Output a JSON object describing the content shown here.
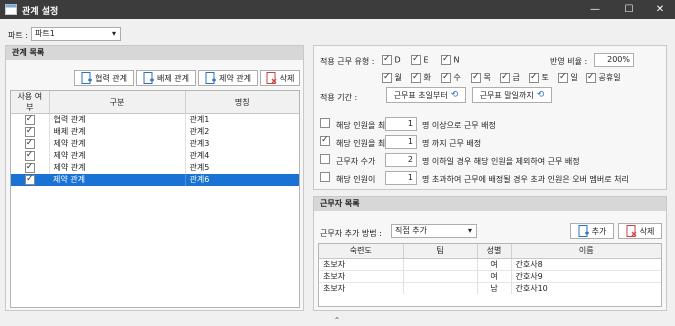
{
  "window": {
    "title": "관계 설정"
  },
  "part": {
    "label": "파트 :",
    "value": "파트1"
  },
  "relation_panel": {
    "title": "관계 목록",
    "buttons": {
      "cooperation": "협력 관계",
      "exclusion": "배제 관계",
      "constraint": "제약 관계",
      "delete": "삭제"
    },
    "columns": [
      "사용 여부",
      "구분",
      "명칭"
    ],
    "rows": [
      {
        "type": "협력 관계",
        "name": "관계1"
      },
      {
        "type": "배제 관계",
        "name": "관계2"
      },
      {
        "type": "제약 관계",
        "name": "관계3"
      },
      {
        "type": "제약 관계",
        "name": "관계4"
      },
      {
        "type": "제약 관계",
        "name": "관계5"
      },
      {
        "type": "제약 관계",
        "name": "관계6"
      }
    ]
  },
  "settings": {
    "duty_type_label": "적용 근무 유형 :",
    "duty_types": [
      "D",
      "E",
      "N"
    ],
    "ratio_label": "반영 비율 :",
    "ratio_value": "200%",
    "days": [
      "월",
      "화",
      "수",
      "목",
      "금",
      "토",
      "일",
      "공휴일"
    ],
    "period_label": "적용 기간 :",
    "period_from": "근무표 초일부터",
    "period_to": "근무표 말일까지",
    "rules": [
      {
        "label": "해당 인원을 최소",
        "value": "1",
        "suffix": "명 이상으로 근무 배정"
      },
      {
        "label": "해당 인원을 최대",
        "value": "1",
        "suffix": "명 까지 근무 배정"
      },
      {
        "label": "근무자 수가",
        "value": "2",
        "suffix": "명 이하일 경우 해당 인원을 제외하여 근무 배정"
      },
      {
        "label": "해당 인원이",
        "value": "1",
        "suffix": "명 초과하여 근무에 배정될 경우 초과 인원은 오버 멤버로 처리"
      }
    ]
  },
  "workers": {
    "title": "근무자 목록",
    "method_label": "근무자 추가 방법 :",
    "method_value": "직접 추가",
    "add": "추가",
    "delete": "삭제",
    "columns": [
      "숙련도",
      "팀",
      "성별",
      "이름"
    ],
    "rows": [
      {
        "skill": "초보자",
        "team": "",
        "gender": "여",
        "name": "간호사8"
      },
      {
        "skill": "초보자",
        "team": "",
        "gender": "여",
        "name": "간호사9"
      },
      {
        "skill": "초보자",
        "team": "",
        "gender": "남",
        "name": "간호사10"
      }
    ]
  },
  "colors": {
    "titlebar": "#3c3c3c",
    "selection": "#1a73d4"
  }
}
